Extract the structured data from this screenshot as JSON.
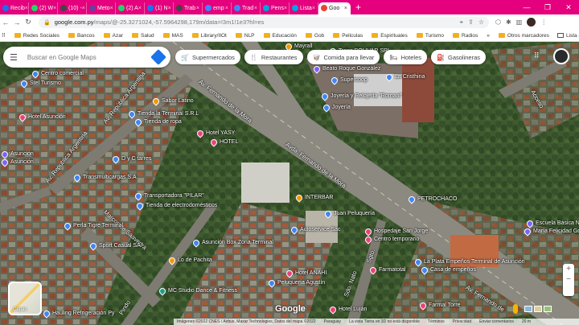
{
  "browser": {
    "tabs": [
      {
        "label": "Recib",
        "color": "#1e6df2"
      },
      {
        "label": "(2) W",
        "color": "#25d366"
      },
      {
        "label": "(10) -",
        "color": "#444444"
      },
      {
        "label": "Meto",
        "color": "#6b3fa0"
      },
      {
        "label": "(2) A",
        "color": "#25d366"
      },
      {
        "label": "(1) N",
        "color": "#1877f2"
      },
      {
        "label": "Trab",
        "color": "#444444"
      },
      {
        "label": "emp",
        "color": "#4285f4"
      },
      {
        "label": "Trad",
        "color": "#4285f4"
      },
      {
        "label": "Pens",
        "color": "#00a3e0"
      },
      {
        "label": "Lista",
        "color": "#00a3e0"
      },
      {
        "label": "Goo",
        "color": "#ea4335"
      }
    ],
    "url_host": "google.com.py",
    "url_path": "/maps/@-25.3271024,-57.5964298,179m/data=!3m1!1e3?hl=es",
    "bookmarks": [
      "Redes Sociales",
      "Bancos",
      "Azar",
      "Salud",
      "MAS",
      "Library/IIOt",
      "NLP",
      "Educación",
      "Gob",
      "Peliculas",
      "Espirituales",
      "Turismo",
      "Radios"
    ],
    "bookmarks_more": "»",
    "other_bookmarks": "Otros marcadores",
    "reading_list": "Lista de lectura"
  },
  "maps": {
    "search_placeholder": "Buscar en Google Maps",
    "chips": [
      {
        "label": "Supermercados",
        "icon": "🛒"
      },
      {
        "label": "Restaurantes",
        "icon": "🍴"
      },
      {
        "label": "Comida para llevar",
        "icon": "🥡"
      },
      {
        "label": "Hoteles",
        "icon": "🛏"
      },
      {
        "label": "Gasolineras",
        "icon": "⛽"
      }
    ],
    "layers_label": "Capas",
    "logo": "Google",
    "footer": [
      "Imágenes ©2022 CNES / Airbus, Maxar Technologies, Datos del mapa ©2022",
      "Paraguay",
      "La vista Tierra en 3D no está disponible",
      "Términos",
      "Privacidad",
      "Enviar comentarios",
      "20 m"
    ],
    "streets": {
      "mcal_lopez_1": "Av. Fernando de la Mora",
      "mcal_lopez_2": "Avda. Fernando de la Mora",
      "republica_argentina": "Av. República Argentina",
      "mcal_sta_cruz": "Av. República Argentina",
      "marcos_de_saavedra": "Marcos de Saavedra",
      "pindo": "Pindo",
      "teniente": "Sdo. Nato",
      "fernando_3": "Avda. Fernando de la",
      "rodado": "Av. Fernando de",
      "stg": "Sgto.",
      "acceso": "Acceso"
    },
    "places": [
      {
        "label": "Centro comercial",
        "kind": "shop"
      },
      {
        "label": "Mayrall",
        "kind": "food"
      },
      {
        "label": "Trans BOLIVAR SRL",
        "kind": "transit"
      },
      {
        "label": "Beato Roque González",
        "kind": "place"
      },
      {
        "label": "La Cristhina",
        "kind": "shop"
      },
      {
        "label": "Stel Turismo",
        "kind": "travel"
      },
      {
        "label": "Sabor Latino",
        "kind": "food"
      },
      {
        "label": "Joyería y Relojería \"Romani\"",
        "kind": "shop"
      },
      {
        "label": "Joyería",
        "kind": "shop"
      },
      {
        "label": "Hotel Asunción",
        "kind": "hotel"
      },
      {
        "label": "Tienda la Terminal S.R.L",
        "kind": "shop"
      },
      {
        "label": "Tienda de ropa",
        "kind": "shop"
      },
      {
        "label": "Hotel YASY",
        "kind": "hotel"
      },
      {
        "label": "HOTEL",
        "kind": "hotel"
      },
      {
        "label": "Asunción",
        "kind": "place"
      },
      {
        "label": "D y C tarres",
        "kind": "shop"
      },
      {
        "label": "Transmulticargas S.A",
        "kind": "transit"
      },
      {
        "label": "Transportadora \"PILAR\"",
        "kind": "transit"
      },
      {
        "label": "Tienda de electrodomésticos",
        "kind": "shop"
      },
      {
        "label": "INTERBAR",
        "kind": "food"
      },
      {
        "label": "PETROCHACO",
        "kind": "fuel"
      },
      {
        "label": "Escuela Básica N-1",
        "kind": "school"
      },
      {
        "label": "María Felicidad Gon",
        "kind": "school"
      },
      {
        "label": "Juan Peluquería",
        "kind": "service"
      },
      {
        "label": "Autoservice Sac",
        "kind": "shop"
      },
      {
        "label": "Hospedaje San Jorge",
        "kind": "hotel"
      },
      {
        "label": "Centro temporario",
        "kind": "hotel"
      },
      {
        "label": "Perla Tigre Terminal",
        "kind": "transit"
      },
      {
        "label": "Sport Casual SA",
        "kind": "shop"
      },
      {
        "label": "Asunción Box Zona Terminal",
        "kind": "shop"
      },
      {
        "label": "Lo de Pachita",
        "kind": "food"
      },
      {
        "label": "La Plata Empeños Terminal de Asunción",
        "kind": "shop"
      },
      {
        "label": "Casa de empeños",
        "kind": "shop"
      },
      {
        "label": "Farmatotal",
        "kind": "pharmacy"
      },
      {
        "label": "Hotel ANAHI",
        "kind": "hotel"
      },
      {
        "label": "Peluquería Agustín",
        "kind": "service"
      },
      {
        "label": "MC Studio Dance & Fitness",
        "kind": "gym"
      },
      {
        "label": "Farmal Torre",
        "kind": "pharmacy"
      },
      {
        "label": "Hotel Luján",
        "kind": "hotel"
      },
      {
        "label": "Hauling Refrigeración Py",
        "kind": "service"
      },
      {
        "label": "Supercoop",
        "kind": "shop"
      },
      {
        "label": "Asunción",
        "kind": "place"
      }
    ],
    "pin_colors": {
      "shop": "#4285f4",
      "food": "#f29900",
      "hotel": "#e8437a",
      "transit": "#4285f4",
      "place": "#7b61ff",
      "travel": "#4285f4",
      "fuel": "#4285f4",
      "school": "#7b61ff",
      "service": "#4285f4",
      "pharmacy": "#e8437a",
      "gym": "#1a9e8c"
    }
  }
}
